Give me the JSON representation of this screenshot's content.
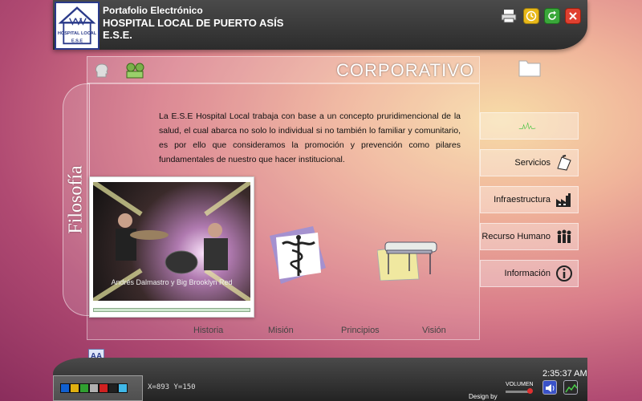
{
  "header": {
    "line1": "Portafolio Electrónico",
    "line2": "HOSPITAL LOCAL DE PUERTO ASÍS",
    "line3": "E.S.E.",
    "logo_text": "HOSPITAL LOCAL",
    "logo_sub": "E.S.E"
  },
  "section_title": "CORPORATIVO",
  "side_tab_label": "Filosofía",
  "body_text": "La E.S.E Hospital Local trabaja con base a un concepto pruridimencional de la salud, el cual abarca no solo lo individual si no también lo familiar y comunitario, es por ello que consideramos la promoción y prevención como pilares fundamentales de nuestro que hacer institucional.",
  "video": {
    "caption": "Andrés Dalmastro y Big Brooklyn Red"
  },
  "bottom_nav": [
    "Historia",
    "Misión",
    "Principios",
    "Visión"
  ],
  "right_menu": [
    "Servicios",
    "Infraestructura",
    "Recurso  Humano",
    "Información"
  ],
  "footer": {
    "coords": "X=893 Y=150",
    "clock": "2:35:37 AM",
    "volume_label": "VOLUMEN",
    "design_label": "Design by",
    "aa_label": "AA",
    "palette": [
      "#1060d0",
      "#e0b010",
      "#30a030",
      "#b0b0b0",
      "#d02020",
      "#202020",
      "#40b8e8"
    ]
  }
}
